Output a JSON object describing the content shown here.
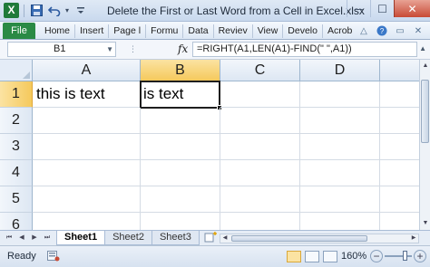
{
  "window": {
    "title": "Delete the First or Last Word from a Cell in Excel.xlsx",
    "logo_icon": "excel-logo-icon",
    "controls": {
      "minimize": "─",
      "maximize": "☐",
      "close": "✕"
    }
  },
  "quick_access": {
    "icons": [
      "save-icon",
      "undo-icon",
      "customize-icon"
    ],
    "undo_arrow": "▾"
  },
  "ribbon": {
    "file_tab": "File",
    "tabs": [
      "Home",
      "Insert",
      "Page l",
      "Formu",
      "Data",
      "Reviev",
      "View",
      "Develo",
      "Acrob"
    ],
    "right_icons": [
      "minimize-ribbon-icon",
      "help-icon",
      "window-restore-icon",
      "window-close-icon"
    ]
  },
  "formula_bar": {
    "name_box": "B1",
    "fx_label": "fx",
    "formula": "=RIGHT(A1,LEN(A1)-FIND(\" \",A1))"
  },
  "grid": {
    "columns": [
      "A",
      "B",
      "C",
      "D"
    ],
    "rows": [
      "1",
      "2",
      "3",
      "4",
      "5",
      "6"
    ],
    "active_cell": "B1",
    "cells": {
      "A1": "this is text",
      "B1": "is text"
    }
  },
  "sheet_tabs": {
    "tabs": [
      "Sheet1",
      "Sheet2",
      "Sheet3"
    ],
    "active": "Sheet1"
  },
  "status_bar": {
    "status": "Ready",
    "zoom": "160%"
  },
  "colors": {
    "file_tab": "#2a8a45",
    "active_header": "#f5c95c",
    "title_bar": "#c9d9ee"
  }
}
